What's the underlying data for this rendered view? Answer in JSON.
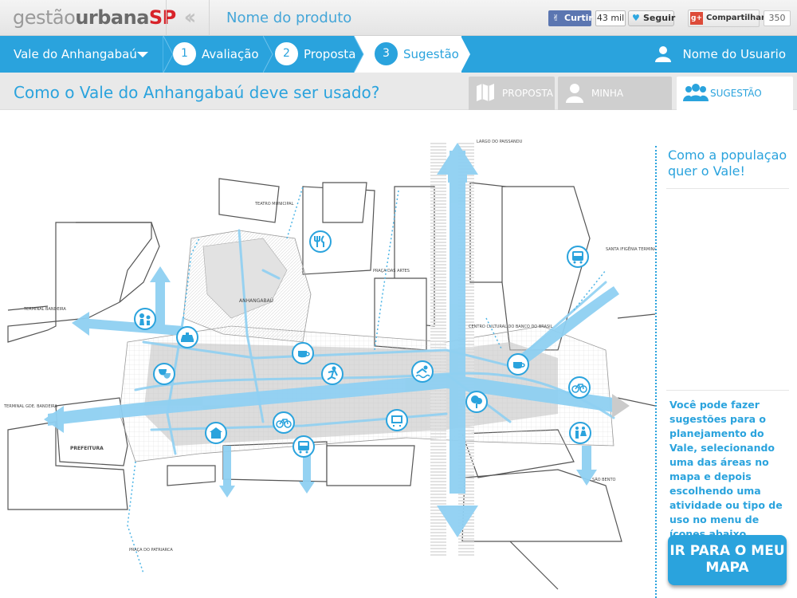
{
  "header": {
    "logo": {
      "part1": "gestão",
      "part2": "urbana",
      "part3": "SP"
    },
    "back_icon": "chevron-double-left",
    "product_name": "Nome do produto",
    "social": {
      "facebook_like": "Curtir",
      "facebook_count": "43 mil",
      "twitter_follow": "Seguir",
      "gplus_share": "Compartilhar",
      "gplus_count": "350"
    }
  },
  "nav": {
    "place": "Vale do Anhangabaú",
    "steps": [
      {
        "num": "1",
        "label": "Avaliação"
      },
      {
        "num": "2",
        "label": "Proposta"
      },
      {
        "num": "3",
        "label": "Sugestão"
      }
    ],
    "active_step": "3",
    "user": "Nome do Usuario"
  },
  "question": "Como o Vale do Anhangabaú deve ser usado?",
  "tabs": [
    {
      "label": "PROPOSTA",
      "icon": "map-icon",
      "active": false
    },
    {
      "label": "MINHA SUGESTÃO",
      "icon": "person-icon",
      "active": false
    },
    {
      "label": "SUGESTÃO GERAL",
      "icon": "people-icon",
      "active": true
    }
  ],
  "map": {
    "labels": {
      "teatro": "TEATRO MUNICIPAL",
      "prefeitura": "PREFEITURA",
      "terminal_bandeira": "TERMINAL BANDEIRA",
      "terminal_gde": "TERMINAL GDE. BANDEIRA",
      "largo_paissandu": "LARGO DO PAISSANDU",
      "santa_ifigenia": "SANTA IFIGÊNIA TERMINAL CORREIO",
      "sao_bento": "SÃO BENTO",
      "praca_patriarca": "PRAÇA DO PATRIARCA",
      "praca_artes": "PRAÇA DAS ARTES",
      "centro_cultural": "CENTRO CULTURAL DO BANCO DO BRASIL",
      "anhangabau_sul": "ANHANGABAÚ"
    },
    "activity_icons": [
      "restaurant-icon",
      "bus-icon",
      "family-icon",
      "taxi-icon",
      "coffee-icon",
      "skate-icon",
      "swim-icon",
      "coffee-icon",
      "bicycle-icon",
      "theater-icon",
      "tree-icon",
      "event-icon",
      "accessibility-icon",
      "bicycle-icon",
      "kiosk-icon",
      "bus-icon",
      "restroom-icon"
    ]
  },
  "sidebar": {
    "title": "Como a populaçao quer o Vale!",
    "help": "Você pode fazer sugestões para o planejamento do Vale, selecionando uma das áreas no mapa e depois escolhendo uma atividade ou tipo de uso no menu de ícones abaixo.",
    "cta": "IR PARA O MEU MAPA"
  },
  "colors": {
    "accent": "#2aa3dd",
    "logo_red": "#d8232a",
    "arrow": "#8fd0f2"
  }
}
